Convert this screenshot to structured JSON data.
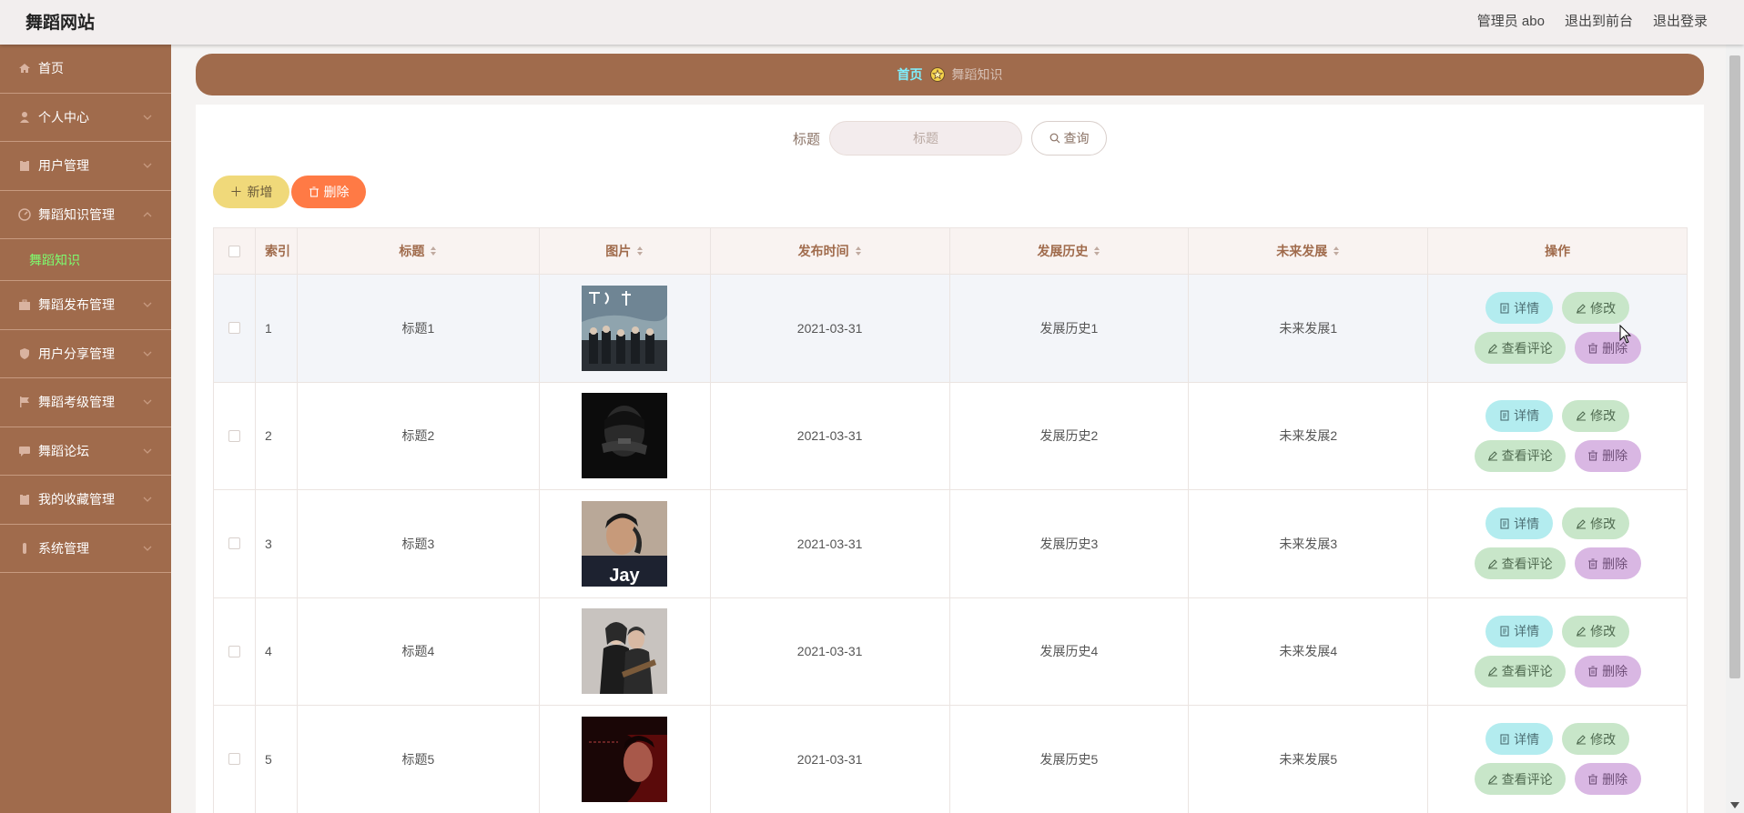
{
  "app": {
    "title": "舞蹈网站"
  },
  "topbar": {
    "user": "管理员 abo",
    "back_front": "退出到前台",
    "logout": "退出登录"
  },
  "sidebar": {
    "items": [
      {
        "label": "首页",
        "icon": "home-icon"
      },
      {
        "label": "个人中心",
        "icon": "user-icon"
      },
      {
        "label": "用户管理",
        "icon": "clipboard-icon"
      },
      {
        "label": "舞蹈知识管理",
        "icon": "dashboard-icon"
      },
      {
        "label": "舞蹈发布管理",
        "icon": "briefcase-icon"
      },
      {
        "label": "用户分享管理",
        "icon": "shield-icon"
      },
      {
        "label": "舞蹈考级管理",
        "icon": "flag-icon"
      },
      {
        "label": "舞蹈论坛",
        "icon": "chat-icon"
      },
      {
        "label": "我的收藏管理",
        "icon": "clipboard-icon"
      },
      {
        "label": "系统管理",
        "icon": "tube-icon"
      }
    ],
    "active_sub": "舞蹈知识"
  },
  "breadcrumb": {
    "home": "首页",
    "current": "舞蹈知识"
  },
  "search": {
    "label": "标题",
    "placeholder": "标题",
    "button": "查询"
  },
  "actions": {
    "add": "新增",
    "delete": "删除"
  },
  "table": {
    "headers": {
      "index": "索引",
      "title": "标题",
      "picture": "图片",
      "date": "发布时间",
      "history": "发展历史",
      "future": "未来发展",
      "ops": "操作"
    },
    "ops": {
      "detail": "详情",
      "edit": "修改",
      "comment": "查看评论",
      "delete": "删除"
    },
    "rows": [
      {
        "index": "1",
        "title": "标题1",
        "date": "2021-03-31",
        "history": "发展历史1",
        "future": "未来发展1",
        "thumb_caption": ""
      },
      {
        "index": "2",
        "title": "标题2",
        "date": "2021-03-31",
        "history": "发展历史2",
        "future": "未来发展2",
        "thumb_caption": ""
      },
      {
        "index": "3",
        "title": "标题3",
        "date": "2021-03-31",
        "history": "发展历史3",
        "future": "未来发展3",
        "thumb_caption": "Jay"
      },
      {
        "index": "4",
        "title": "标题4",
        "date": "2021-03-31",
        "history": "发展历史4",
        "future": "未来发展4",
        "thumb_caption": ""
      },
      {
        "index": "5",
        "title": "标题5",
        "date": "2021-03-31",
        "history": "发展历史5",
        "future": "未来发展5",
        "thumb_caption": ""
      }
    ]
  },
  "colors": {
    "brand": "#a06b4c",
    "active_sub": "#7dff6f",
    "breadcrumb_home": "#7ff0ff"
  }
}
